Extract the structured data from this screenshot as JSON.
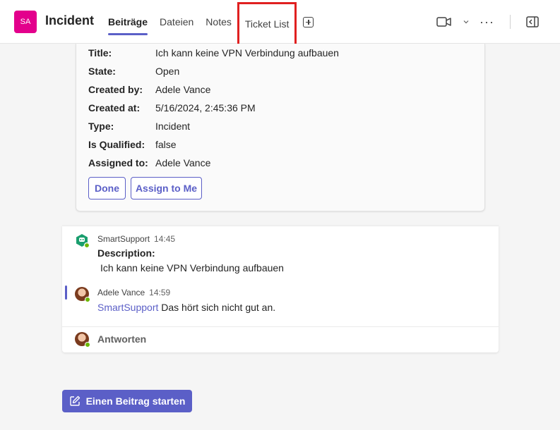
{
  "header": {
    "team_initials": "SA",
    "channel_title": "Incident",
    "tabs": [
      {
        "label": "Beiträge"
      },
      {
        "label": "Dateien"
      },
      {
        "label": "Notes"
      },
      {
        "label": "Ticket List"
      }
    ],
    "icons": {
      "add_tab": "plus-square-icon",
      "video": "video-camera-icon",
      "more": "more-horizontal-icon",
      "panel": "side-panel-icon"
    }
  },
  "ticket": {
    "fields": [
      {
        "label": "Title:",
        "value": "Ich kann keine VPN Verbindung aufbauen"
      },
      {
        "label": "State:",
        "value": "Open"
      },
      {
        "label": "Created by:",
        "value": "Adele Vance"
      },
      {
        "label": "Created at:",
        "value": "5/16/2024, 2:45:36 PM"
      },
      {
        "label": "Type:",
        "value": "Incident"
      },
      {
        "label": "Is Qualified:",
        "value": "false"
      },
      {
        "label": "Assigned to:",
        "value": "Adele Vance"
      }
    ],
    "buttons": {
      "done": "Done",
      "assign": "Assign to Me"
    }
  },
  "conversation": {
    "messages": [
      {
        "author": "SmartSupport",
        "time": "14:45",
        "heading": "Description:",
        "text": "Ich kann keine VPN Verbindung aufbauen"
      },
      {
        "author": "Adele Vance",
        "time": "14:59",
        "mention": "SmartSupport",
        "text": "Das hört sich nicht gut an."
      }
    ],
    "reply_label": "Antworten"
  },
  "new_post": {
    "label": "Einen Beitrag starten"
  },
  "colors": {
    "accent": "#5b5fc7",
    "team_avatar": "#e3008c",
    "highlight_box": "#e02020",
    "presence_available": "#6bb700"
  }
}
